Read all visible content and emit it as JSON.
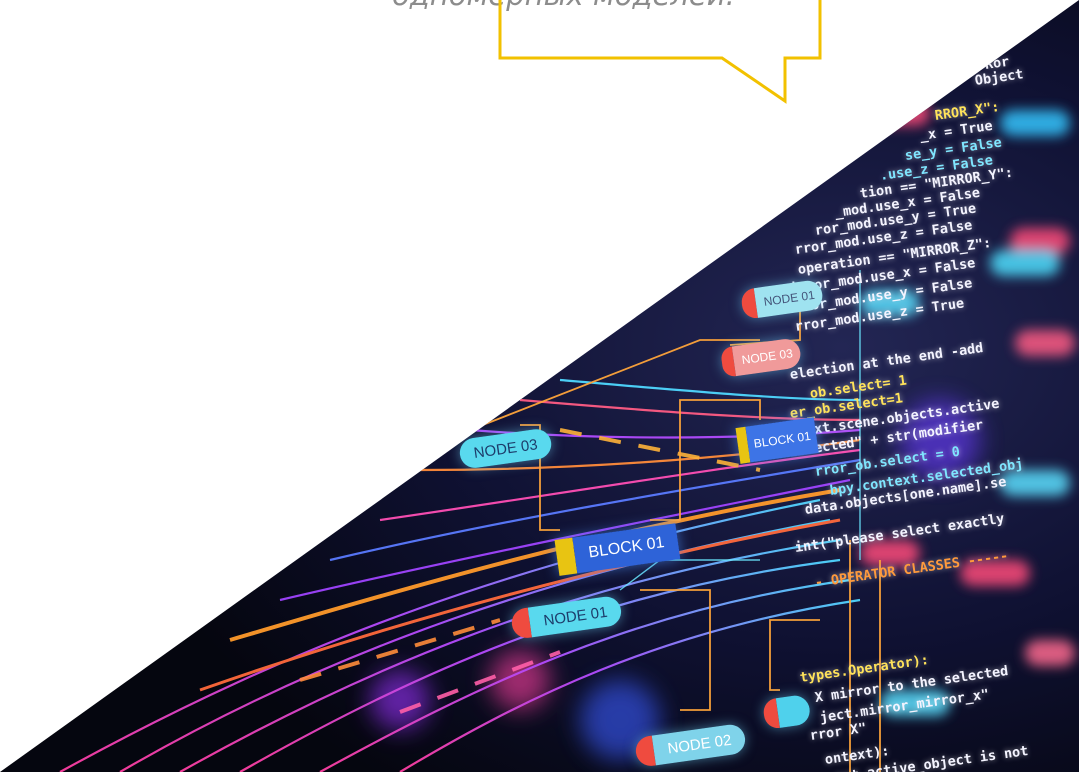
{
  "bubble": {
    "text": "одномерных моделей.",
    "border_color": "#f2c100"
  },
  "labels": {
    "block_01": "BLOCK 01",
    "block_01_small": "BLOCK 01",
    "node_01": "NODE 01",
    "node_02": "NODE 02",
    "node_03": "NODE 03",
    "node_03_small": "NODE 03",
    "node_03_left": "NODE 03",
    "node_01_top": "NODE 01"
  },
  "code_lines": [
    "Ror",
    "Object",
    "RROR_X\":",
    "_x = True",
    "se_y = False",
    ".use_z = False",
    "tion == \"MIRROR_Y\":",
    "_mod.use_x = False",
    "ror_mod.use_y = True",
    "rror_mod.use_z = False",
    "operation == \"MIRROR_Z\":",
    "irror_mod.use_x = False",
    "rror_mod.use_y = False",
    "rror_mod.use_z = True",
    "election at the end -add",
    "ob.select= 1",
    "er_ob.select=1",
    "ntext.scene.objects.active",
    "Selected\" + str(modifier",
    "rror_ob.select = 0",
    "bpy.context.selected_obj",
    "data.objects[one.name].se",
    "int(\"please select exactly",
    "- OPERATOR CLASSES -----",
    "types.Operator):",
    "X mirror to the selected",
    "ject.mirror_mirror_x\"",
    "rror X\"",
    "ontext):",
    "ext.active_object is not"
  ],
  "colors": {
    "code_white": "#f4f4ff",
    "node_cyan": "#59d9ee",
    "node_cap": "#ef4b3f",
    "block_blue": "#2e63d8",
    "block_cap": "#e8c412",
    "background_dark": "#0a0b1e"
  }
}
